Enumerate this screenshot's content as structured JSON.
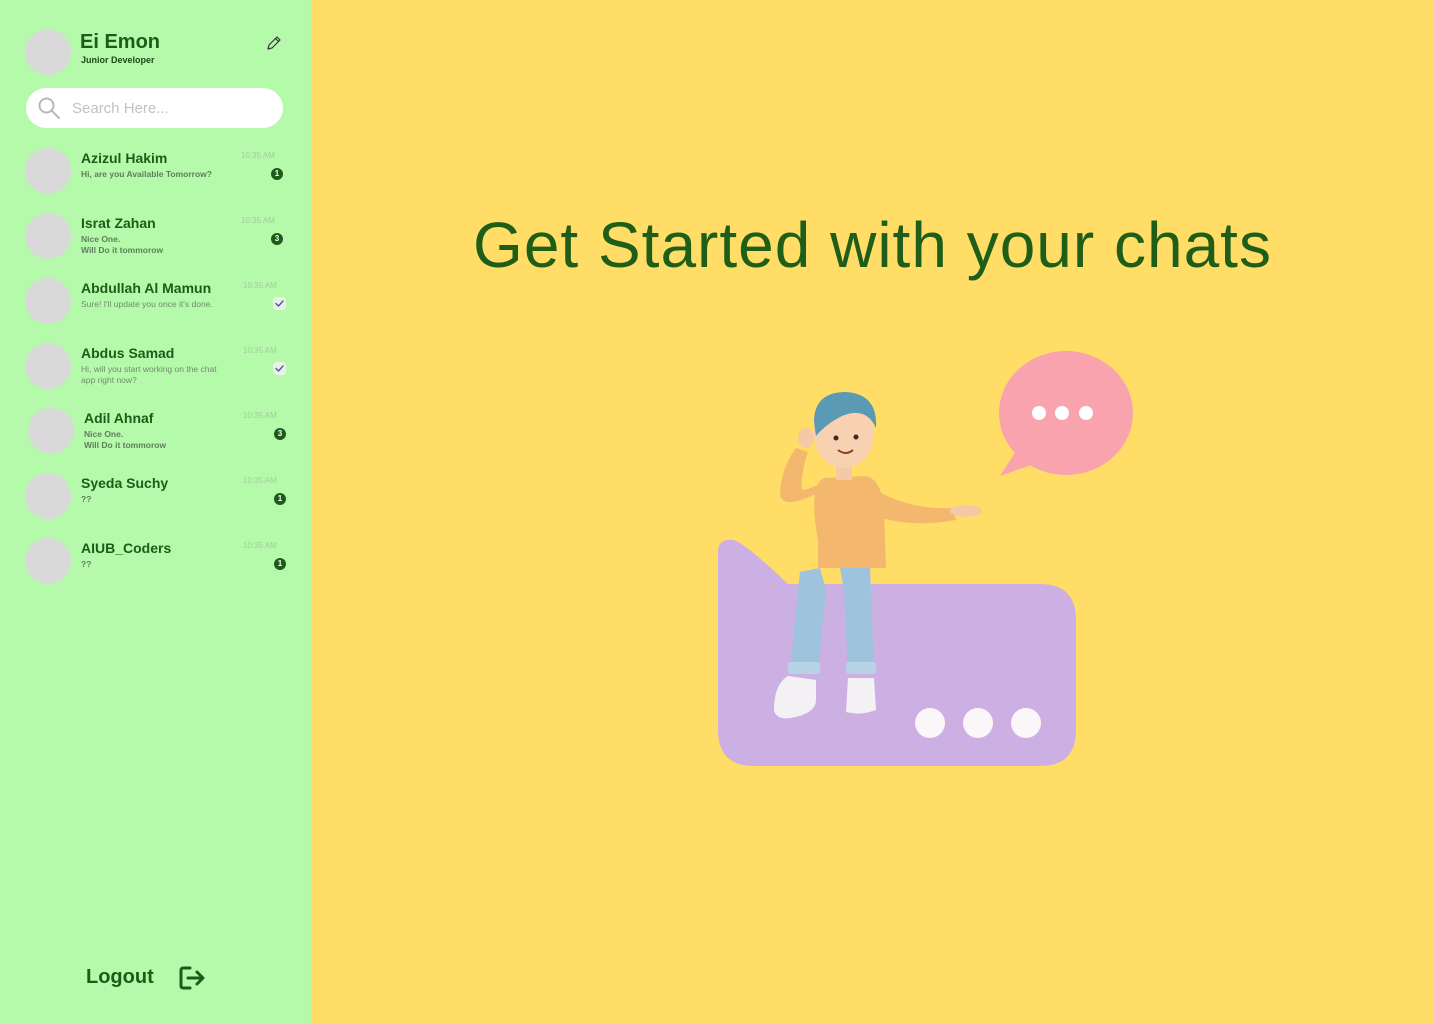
{
  "profile": {
    "name": "Ei Emon",
    "role": "Junior Developer",
    "edit_icon": "pencil-icon"
  },
  "search": {
    "placeholder": "Search Here...",
    "value": "",
    "icon": "search-icon"
  },
  "chats": [
    {
      "name": "Azizul Hakim",
      "message": "Hi, are you Available Tomorrow?",
      "time": "10:35 AM",
      "badge": "1",
      "status": "unread",
      "bold": true
    },
    {
      "name": "Israt Zahan",
      "message": "Nice One.\nWill Do it tommorow",
      "time": "10:35 AM",
      "badge": "3",
      "status": "unread",
      "bold": true
    },
    {
      "name": "Abdullah Al Mamun",
      "message": "Sure! I'll update you once it's done.",
      "time": "10:35 AM",
      "badge": "",
      "status": "read",
      "bold": false
    },
    {
      "name": "Abdus Samad",
      "message": "Hi, will you start working on the chat app right now?",
      "time": "10:35 AM",
      "badge": "",
      "status": "read",
      "bold": false
    },
    {
      "name": "Adil Ahnaf",
      "message": "Nice One.\nWill Do it tommorow",
      "time": "10:35 AM",
      "badge": "3",
      "status": "unread",
      "bold": true
    },
    {
      "name": "Syeda Suchy",
      "message": "??",
      "time": "10:35 AM",
      "badge": "1",
      "status": "unread",
      "bold": true
    },
    {
      "name": "AIUB_Coders",
      "message": "??",
      "time": "10:35 AM",
      "badge": "1",
      "status": "unread",
      "bold": true
    }
  ],
  "logout": {
    "label": "Logout",
    "icon": "logout-icon"
  },
  "main": {
    "title": "Get Started with your chats",
    "illustration": "person-sitting-on-chat-bubble-illustration"
  },
  "colors": {
    "sidebar_bg": "#B5F9AB",
    "main_bg": "#FFDD66",
    "accent": "#1D5C18"
  }
}
